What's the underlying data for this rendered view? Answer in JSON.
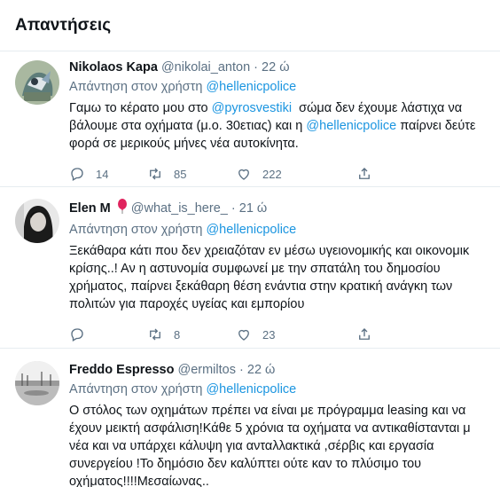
{
  "header": {
    "title": "Απαντήσεις"
  },
  "tweets": [
    {
      "name": "Nikolaos Kapa",
      "handle": "@nikolai_anton",
      "dot": "·",
      "time": "22 ώ",
      "reply_prefix": "Απάντηση στον χρήστη",
      "reply_handle": "@hellenicpolice",
      "lines": {
        "l1a": "Γαμω το κέρατο μου στο ",
        "l1b": "@pyrosvestiki",
        "l1c": "  σώμα δεν έχουμε λάστιχα να",
        "l2": "βάλουμε στα οχήματα (μ.ο. 30ετιας) και η ",
        "l2b": "@hellenicpolice",
        "l2c": " παίρνει δεύτε",
        "l3": "φορά σε μερικούς μήνες νέα αυτοκίνητα."
      },
      "replies": "14",
      "retweets": "85",
      "likes": "222"
    },
    {
      "name": "Elen M",
      "badge": "balloon-icon",
      "handle": "@what_is_here_",
      "dot": "·",
      "time": "21 ώ",
      "reply_prefix": "Απάντηση στον χρήστη",
      "reply_handle": "@hellenicpolice",
      "lines": [
        "Ξεκάθαρα κάτι που δεν χρειαζόταν εν μέσω υγειονομικής και οικονομικ",
        "κρίσης..! Αν η αστυνομία συμφωνεί με την σπατάλη του δημοσίου",
        "χρήματος, παίρνει ξεκάθαρη θέση ενάντια στην κρατική ανάγκη των",
        "πολιτών για παροχές υγείας και εμπορίου"
      ],
      "replies": "",
      "retweets": "8",
      "likes": "23"
    },
    {
      "name": "Freddo Espresso",
      "handle": "@ermiltos",
      "dot": "·",
      "time": "22 ώ",
      "reply_prefix": "Απάντηση στον χρήστη",
      "reply_handle": "@hellenicpolice",
      "lines": [
        "Ο στόλος των οχημάτων πρέπει να είναι με πρόγραμμα leasing και να",
        "έχουν μεικτή ασφάλιση!Κάθε 5 χρόνια τα οχήματα να αντικαθίστανται μ",
        "νέα και να υπάρχει κάλυψη για ανταλλακτικά ,σέρβις και εργασία",
        "συνεργείου !Το δημόσιο δεν καλύπτει ούτε καν το πλύσιμο του",
        "οχήματος!!!!Μεσαίωνας.."
      ]
    }
  ],
  "colors": {
    "link": "#1b95e0",
    "secondary": "#5b7083",
    "text": "#0f1419",
    "divider": "#e6ecf0"
  }
}
